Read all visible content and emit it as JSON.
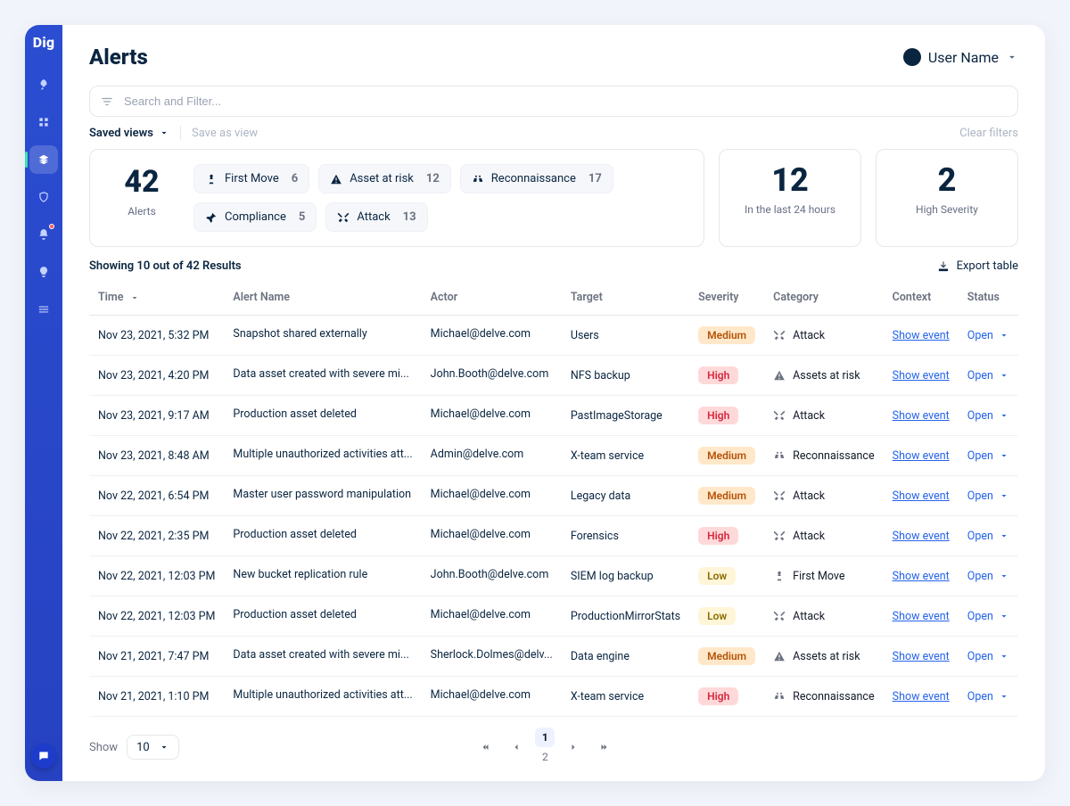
{
  "header": {
    "title": "Alerts",
    "user_name": "User Name"
  },
  "search": {
    "placeholder": "Search and Filter..."
  },
  "views": {
    "saved_label": "Saved views",
    "save_as_label": "Save as view",
    "clear_label": "Clear filters"
  },
  "kpi": {
    "alerts": {
      "value": "42",
      "label": "Alerts"
    },
    "last24": {
      "value": "12",
      "label": "In the last 24 hours"
    },
    "high": {
      "value": "2",
      "label": "High Severity"
    }
  },
  "filters": [
    {
      "icon": "chess-icon",
      "label": "First Move",
      "count": "6"
    },
    {
      "icon": "warning-icon",
      "label": "Asset at risk",
      "count": "12"
    },
    {
      "icon": "binoculars-icon",
      "label": "Reconnaissance",
      "count": "17"
    },
    {
      "icon": "pin-icon",
      "label": "Compliance",
      "count": "5"
    },
    {
      "icon": "crossed-swords-icon",
      "label": "Attack",
      "count": "13"
    }
  ],
  "results": {
    "text": "Showing 10 out of 42 Results",
    "export_label": "Export table"
  },
  "columns": {
    "time": "Time",
    "alert": "Alert Name",
    "actor": "Actor",
    "target": "Target",
    "severity": "Severity",
    "category": "Category",
    "context": "Context",
    "status": "Status"
  },
  "labels": {
    "show_event": "Show event",
    "open": "Open",
    "show": "Show"
  },
  "pagination": {
    "page_size": "10",
    "pages": [
      "1",
      "2"
    ],
    "current": 1
  },
  "rows": [
    {
      "time": "Nov 23, 2021, 5:32 PM",
      "alert": "Snapshot shared externally",
      "actor": "Michael@delve.com",
      "target": "Users",
      "severity": "Medium",
      "category": "Attack",
      "cat_icon": "crossed-swords-icon"
    },
    {
      "time": "Nov 23, 2021, 4:20 PM",
      "alert": "Data asset created with severe mi...",
      "actor": "John.Booth@delve.com",
      "target": "NFS backup",
      "severity": "High",
      "category": "Assets at risk",
      "cat_icon": "warning-icon"
    },
    {
      "time": "Nov 23, 2021, 9:17 AM",
      "alert": "Production asset deleted",
      "actor": "Michael@delve.com",
      "target": "PastImageStorage",
      "severity": "High",
      "category": "Attack",
      "cat_icon": "crossed-swords-icon"
    },
    {
      "time": "Nov 23, 2021, 8:48 AM",
      "alert": "Multiple unauthorized activities att...",
      "actor": "Admin@delve.com",
      "target": "X-team service",
      "severity": "Medium",
      "category": "Reconnaissance",
      "cat_icon": "binoculars-icon"
    },
    {
      "time": "Nov 22, 2021, 6:54 PM",
      "alert": "Master user password manipulation",
      "actor": "Michael@delve.com",
      "target": "Legacy data",
      "severity": "Medium",
      "category": "Attack",
      "cat_icon": "crossed-swords-icon"
    },
    {
      "time": "Nov 22, 2021, 2:35 PM",
      "alert": "Production asset deleted",
      "actor": "Michael@delve.com",
      "target": "Forensics",
      "severity": "High",
      "category": "Attack",
      "cat_icon": "crossed-swords-icon"
    },
    {
      "time": "Nov 22, 2021, 12:03 PM",
      "alert": "New bucket replication rule",
      "actor": "John.Booth@delve.com",
      "target": "SIEM log backup",
      "severity": "Low",
      "category": "First Move",
      "cat_icon": "chess-icon"
    },
    {
      "time": "Nov 22, 2021, 12:03 PM",
      "alert": "Production asset deleted",
      "actor": "Michael@delve.com",
      "target": "ProductionMirrorStats",
      "severity": "Low",
      "category": "Attack",
      "cat_icon": "crossed-swords-icon"
    },
    {
      "time": "Nov 21, 2021, 7:47 PM",
      "alert": "Data asset created with severe mi...",
      "actor": "Sherlock.Dolmes@delv...",
      "target": "Data engine",
      "severity": "Medium",
      "category": "Assets at risk",
      "cat_icon": "warning-icon"
    },
    {
      "time": "Nov 21, 2021, 1:10 PM",
      "alert": "Multiple unauthorized activities att...",
      "actor": "Michael@delve.com",
      "target": "X-team service",
      "severity": "High",
      "category": "Reconnaissance",
      "cat_icon": "binoculars-icon"
    }
  ]
}
